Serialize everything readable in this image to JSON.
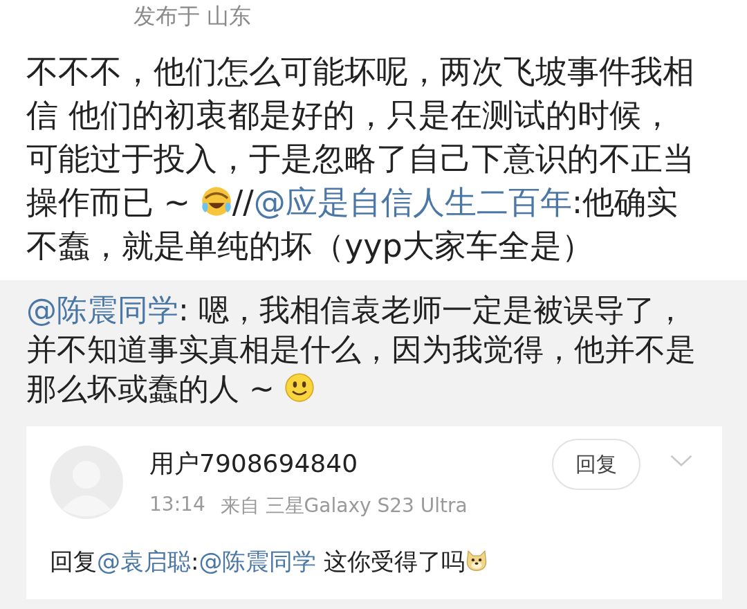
{
  "location": "发布于 山东",
  "post": {
    "segments": [
      {
        "kind": "text",
        "text": "不不不，他们怎么可能坏呢，两次飞坡事件我相信 他们的初衷都是好的，只是在测试的时候，可能过于投入，于是忽略了自己下意识的不正当操作而已 ~ "
      },
      {
        "kind": "laughcry"
      },
      {
        "kind": "text",
        "text": "//"
      },
      {
        "kind": "mention",
        "text": "@应是自信人生二百年"
      },
      {
        "kind": "text",
        "text": ":他确实不蠢，就是单纯的坏（yyp大家车全是）"
      }
    ]
  },
  "quoted": {
    "segments": [
      {
        "kind": "mention",
        "text": "@陈震同学"
      },
      {
        "kind": "text",
        "text": ": 嗯，我相信袁老师一定是被误导了，并不知道事实真相是什么，因为我觉得，他并不是那么坏或蠢的人 ~ "
      },
      {
        "kind": "smile"
      }
    ]
  },
  "reply": {
    "author": "用户7908694840",
    "time": "13:14",
    "source": "来自 三星Galaxy S23 Ultra",
    "reply_button": "回复",
    "segments": [
      {
        "kind": "text",
        "text": "回复"
      },
      {
        "kind": "mention",
        "text": "@袁启聪"
      },
      {
        "kind": "text",
        "text": ":"
      },
      {
        "kind": "mention",
        "text": "@陈震同学"
      },
      {
        "kind": "text",
        "text": " 这你受得了吗"
      },
      {
        "kind": "doge"
      }
    ]
  }
}
